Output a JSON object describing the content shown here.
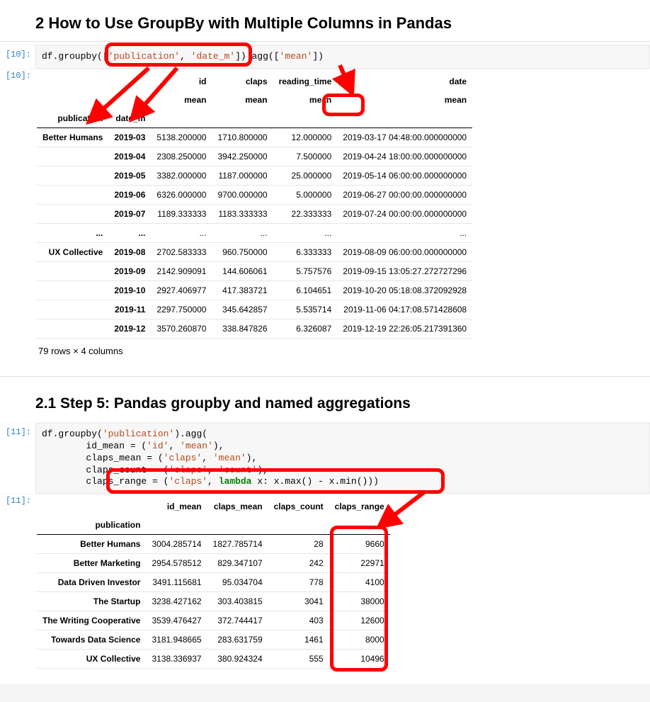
{
  "section2": {
    "heading": "2  How to Use GroupBy with Multiple Columns in Pandas"
  },
  "cell10": {
    "prompt_in": "[10]:",
    "prompt_out": "[10]:",
    "code": {
      "p1": "df.groupby(",
      "p2": "[",
      "s1": "'publication'",
      "c1": ", ",
      "s2": "'date_m'",
      "p3": "]",
      "p4": ").agg([",
      "s3": "'mean'",
      "p5": "])"
    },
    "headers_top": [
      "",
      "",
      "id",
      "claps",
      "reading_time",
      "date"
    ],
    "headers_sub": [
      "",
      "",
      "mean",
      "mean",
      "mean",
      "mean"
    ],
    "headers_idx": [
      "publication",
      "date_m",
      "",
      "",
      "",
      ""
    ],
    "rows_a": [
      [
        "Better Humans",
        "2019-03",
        "5138.200000",
        "1710.800000",
        "12.000000",
        "2019-03-17 04:48:00.000000000"
      ],
      [
        "",
        "2019-04",
        "2308.250000",
        "3942.250000",
        "7.500000",
        "2019-04-24 18:00:00.000000000"
      ],
      [
        "",
        "2019-05",
        "3382.000000",
        "1187.000000",
        "25.000000",
        "2019-05-14 06:00:00.000000000"
      ],
      [
        "",
        "2019-06",
        "6326.000000",
        "9700.000000",
        "5.000000",
        "2019-06-27 00:00:00.000000000"
      ],
      [
        "",
        "2019-07",
        "1189.333333",
        "1183.333333",
        "22.333333",
        "2019-07-24 00:00:00.000000000"
      ]
    ],
    "row_ellipsis": [
      "...",
      "...",
      "...",
      "...",
      "...",
      "..."
    ],
    "rows_b": [
      [
        "UX Collective",
        "2019-08",
        "2702.583333",
        "960.750000",
        "6.333333",
        "2019-08-09 06:00:00.000000000"
      ],
      [
        "",
        "2019-09",
        "2142.909091",
        "144.606061",
        "5.757576",
        "2019-09-15 13:05:27.272727296"
      ],
      [
        "",
        "2019-10",
        "2927.406977",
        "417.383721",
        "6.104651",
        "2019-10-20 05:18:08.372092928"
      ],
      [
        "",
        "2019-11",
        "2297.750000",
        "345.642857",
        "5.535714",
        "2019-11-06 04:17:08.571428608"
      ],
      [
        "",
        "2019-12",
        "3570.260870",
        "338.847826",
        "6.326087",
        "2019-12-19 22:26:05.217391360"
      ]
    ],
    "footer": "79 rows × 4 columns"
  },
  "section21": {
    "heading": "2.1  Step 5: Pandas groupby and named aggregations"
  },
  "cell11": {
    "prompt_in": "[11]:",
    "prompt_out": "[11]:",
    "code": {
      "l1a": "df.groupby(",
      "l1s": "'publication'",
      "l1b": ").agg(",
      "l2a": "        id_mean = (",
      "l2s1": "'id'",
      "l2c": ", ",
      "l2s2": "'mean'",
      "l2b": "),",
      "l3a": "        claps_mean = (",
      "l3s1": "'claps'",
      "l3c": ", ",
      "l3s2": "'mean'",
      "l3b": "),",
      "l4a": "        claps_count = (",
      "l4s1": "'claps'",
      "l4c": ", ",
      "l4s2": "'count'",
      "l4b": "),",
      "l5a": "        claps_range = (",
      "l5s1": "'claps'",
      "l5c": ", ",
      "l5kw": "lambda",
      "l5b": " x: x.max() - x.min()))"
    },
    "headers": [
      "",
      "id_mean",
      "claps_mean",
      "claps_count",
      "claps_range"
    ],
    "idx_label": "publication",
    "rows": [
      [
        "Better Humans",
        "3004.285714",
        "1827.785714",
        "28",
        "9660"
      ],
      [
        "Better Marketing",
        "2954.578512",
        "829.347107",
        "242",
        "22971"
      ],
      [
        "Data Driven Investor",
        "3491.115681",
        "95.034704",
        "778",
        "4100"
      ],
      [
        "The Startup",
        "3238.427162",
        "303.403815",
        "3041",
        "38000"
      ],
      [
        "The Writing Cooperative",
        "3539.476427",
        "372.744417",
        "403",
        "12600"
      ],
      [
        "Towards Data Science",
        "3181.948665",
        "283.631759",
        "1461",
        "8000"
      ],
      [
        "UX Collective",
        "3138.336937",
        "380.924324",
        "555",
        "10496"
      ]
    ]
  }
}
